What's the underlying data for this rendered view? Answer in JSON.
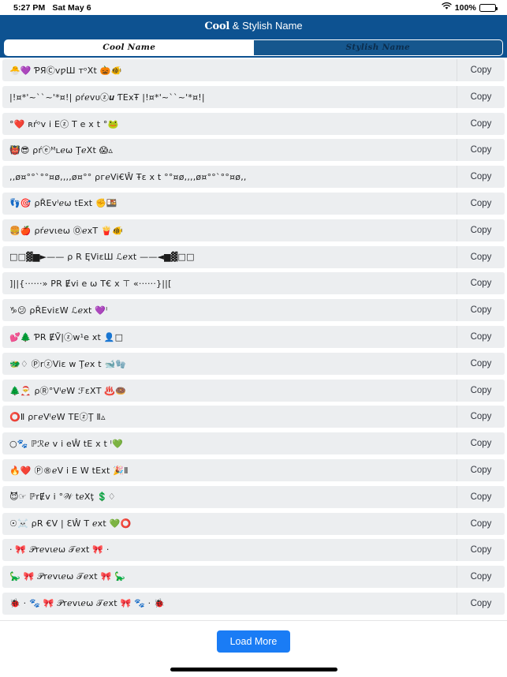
{
  "statusbar": {
    "time": "5:27 PM",
    "date": "Sat May 6",
    "wifi_icon": "wifi-icon",
    "battery_percent": "100%",
    "battery_icon": "battery-full-icon"
  },
  "header": {
    "title_fancy": "Cool",
    "title_plain": " & Stylish Name"
  },
  "tabs": [
    {
      "label": "Cool Name",
      "active": true,
      "name": "tab-cool-name"
    },
    {
      "label": "Stylish Name",
      "active": false,
      "name": "tab-stylish-name"
    }
  ],
  "list": {
    "copy_label": "Copy",
    "rows": [
      {
        "text": "🐣💜 ƤЯⒸᴠƿШ ᴛᵒXt 🎃🐠"
      },
      {
        "text": "|!¤*'~``~'*¤!| ρŕℯᴠᴜⓩ𝒖 ƬΕхŦ |!¤*'~``~'*¤!|"
      },
      {
        "text": "°❤️  ʀŕᵒv i Eⓩ T e x t °🐸"
      },
      {
        "text": "👹😎  ρŕⓔᴹʟℯω ŢℯΧt 😱▵"
      },
      {
        "text": ",,ø¤°°`°°¤ø,,,,ø¤°° ρгℯVi€Ŵ Ŧε x t °°¤ø,,,,ø¤°°`°°¤ø,,"
      },
      {
        "text": "👣🎯 ρŘEᴠᴵℯω tЕхt ✊🍱"
      },
      {
        "text": "🍔🍎 ρŕℯvιeω ⓄℯхT 🍟🐠"
      },
      {
        "text": "□□▓▆►—— ρ R ĘViεШ ℒℯхt ——◄▆▓□□"
      },
      {
        "text": "]||{······» ΡR Ɇvi e ω T€ x ⊤ «······}||["
      },
      {
        "text": "♑😕  ρŘEviεW ℒℯхt 💜ᴵ"
      },
      {
        "text": "💕🌲 ƤR ɆṼ|ⓩw¹e xt 👤□"
      },
      {
        "text": "🐲♢ ⓅrⓩViε w Ţℯx t 🐋🧤"
      },
      {
        "text": "🌲🎅 ρⓇ°VᴵℯW ℱεΧT ♨️🍩"
      },
      {
        "text": "⭕Ⅱ ρгℯVᴵℯW ΤΕⓩŢ Ⅱ▵"
      },
      {
        "text": "○🐾 ℙℛℯ v i eŴ tЕ x t ᴵ💚"
      },
      {
        "text": "🔥❤️ Ⓟ®ℯV i Ε W tЕxt 🎉Ⅱ"
      },
      {
        "text": "😈☞ ℙrɆv i °𝒲 tℯXţ 💲♢"
      },
      {
        "text": "☉☠️ ρR €V | ƐŴ T ℯxt 💚⭕"
      },
      {
        "text": "· 🎀 𝒫rℯᴠιℯω 𝒯ℯхt 🎀 ·"
      },
      {
        "text": "🦕 🎀 𝒫rℯᴠιℯω 𝒯ℯхt 🎀 🦕"
      },
      {
        "text": "🐞 · 🐾 🎀 𝒫rℯᴠιℯω 𝒯ℯхt 🎀 🐾 · 🐞"
      }
    ]
  },
  "footer": {
    "load_more_label": "Load More"
  },
  "colors": {
    "header_blue": "#0d5291",
    "tab_inactive_blue": "#16578e",
    "row_grey": "#eceef0",
    "load_more_blue": "#1a7cf5"
  }
}
